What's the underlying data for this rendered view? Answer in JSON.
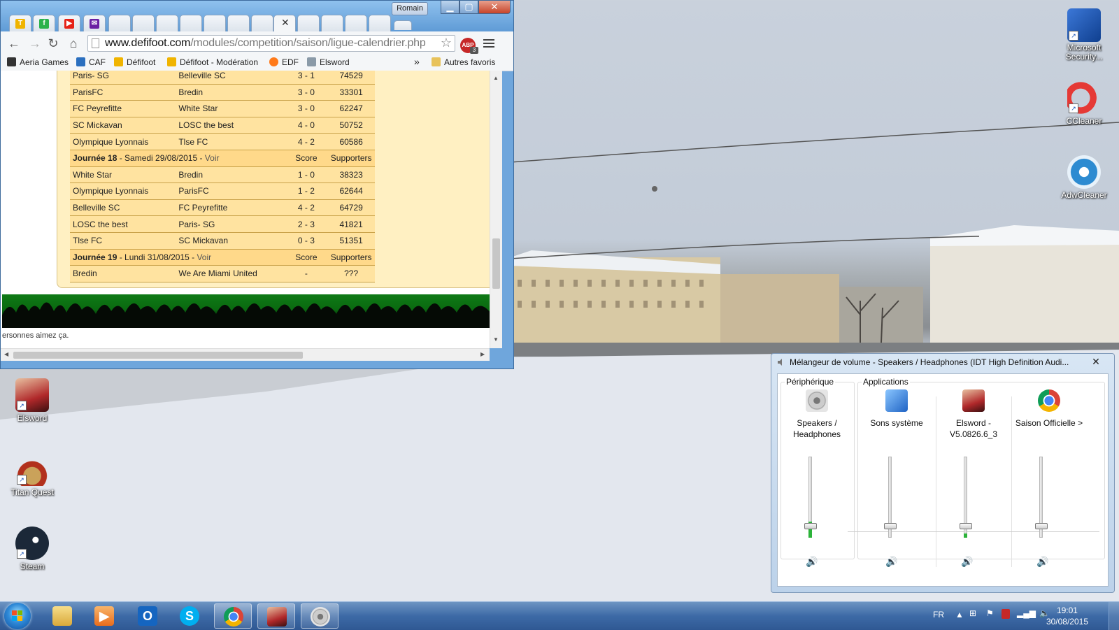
{
  "browser": {
    "user_label": "Romain",
    "close_tab_glyph": "✕",
    "url_host": "www.defifoot.com",
    "url_path": "/modules/competition/saison/ligue-calendrier.php",
    "abp_badge": "ABP",
    "abp_count": "3",
    "bookmarks": [
      "Aeria Games",
      "CAF",
      "Défifoot",
      "Défifoot - Modération",
      "EDF",
      "Elsword"
    ],
    "bookmarks_more": "»",
    "other_bookmarks": "Autres favoris",
    "tab_icons": [
      "defifoot-tab-icon",
      "feedly-tab-icon",
      "youtube-tab-icon",
      "yahoo-mail-tab-icon"
    ]
  },
  "calendar": {
    "score_header": "Score",
    "supporters_header": "Supporters",
    "voir": "Voir",
    "rows_top": [
      {
        "home": "Paris- SG",
        "away": "Belleville SC",
        "score": "3 - 1",
        "supporters": "74529"
      },
      {
        "home": "ParisFC",
        "away": "Bredin",
        "score": "3 - 0",
        "supporters": "33301"
      },
      {
        "home": "FC Peyrefitte",
        "away": "White Star",
        "score": "3 - 0",
        "supporters": "62247"
      },
      {
        "home": "SC Mickavan",
        "away": "LOSC the best",
        "score": "4 - 0",
        "supporters": "50752"
      },
      {
        "home": "Olympique Lyonnais",
        "away": "Tlse FC",
        "score": "4 - 2",
        "supporters": "60586"
      }
    ],
    "journee18": {
      "label": "Journée 18",
      "date": " - Samedi 29/08/2015 - "
    },
    "rows_18": [
      {
        "home": "White Star",
        "away": "Bredin",
        "score": "1 - 0",
        "supporters": "38323"
      },
      {
        "home": "Olympique Lyonnais",
        "away": "ParisFC",
        "score": "1 - 2",
        "supporters": "62644"
      },
      {
        "home": "Belleville SC",
        "away": "FC Peyrefitte",
        "score": "4 - 2",
        "supporters": "64729"
      },
      {
        "home": "LOSC the best",
        "away": "Paris- SG",
        "score": "2 - 3",
        "supporters": "41821"
      },
      {
        "home": "Tlse FC",
        "away": "SC Mickavan",
        "score": "0 - 3",
        "supporters": "51351"
      }
    ],
    "journee19": {
      "label": "Journée 19",
      "date": " - Lundi 31/08/2015 - "
    },
    "rows_19": [
      {
        "home": "Bredin",
        "away": "We Are Miami United",
        "score": "-",
        "supporters": "???"
      }
    ],
    "fb_text": "ersonnes aimez ça."
  },
  "desktop_icons": {
    "microsoft_security": "Microsoft Security...",
    "ccleaner": "CCleaner",
    "adwcleaner": "AdwCleaner",
    "elsword": "Elsword",
    "titan_quest": "Titan Quest",
    "steam": "Steam"
  },
  "mixer": {
    "title": "Mélangeur de volume - Speakers / Headphones (IDT High Definition Audi...",
    "close": "✕",
    "device_group": "Périphérique",
    "apps_group": "Applications",
    "channels": [
      {
        "name_line1": "Speakers /",
        "name_line2": "Headphones",
        "level": 0.2,
        "knob": 0.1
      },
      {
        "name_line1": "Sons système",
        "name_line2": "",
        "level": 0.0,
        "knob": 0.1
      },
      {
        "name_line1": "Elsword -",
        "name_line2": "V5.0826.6_3",
        "level": 0.05,
        "knob": 0.1
      },
      {
        "name_line1": "Saison Officielle >",
        "name_line2": "",
        "level": 0.0,
        "knob": 0.1
      }
    ],
    "speaker_glyph": "🔊"
  },
  "taskbar": {
    "language": "FR",
    "time": "19:01",
    "date": "30/08/2015",
    "items": [
      "explorer",
      "media-player",
      "outlook",
      "skype",
      "chrome",
      "elsword",
      "volume-mixer"
    ]
  },
  "colors": {
    "table_row": "#ffe3a0",
    "table_head": "#ffd98a",
    "level_green": "#2cb33a",
    "taskbar": "#3d6aa6"
  }
}
